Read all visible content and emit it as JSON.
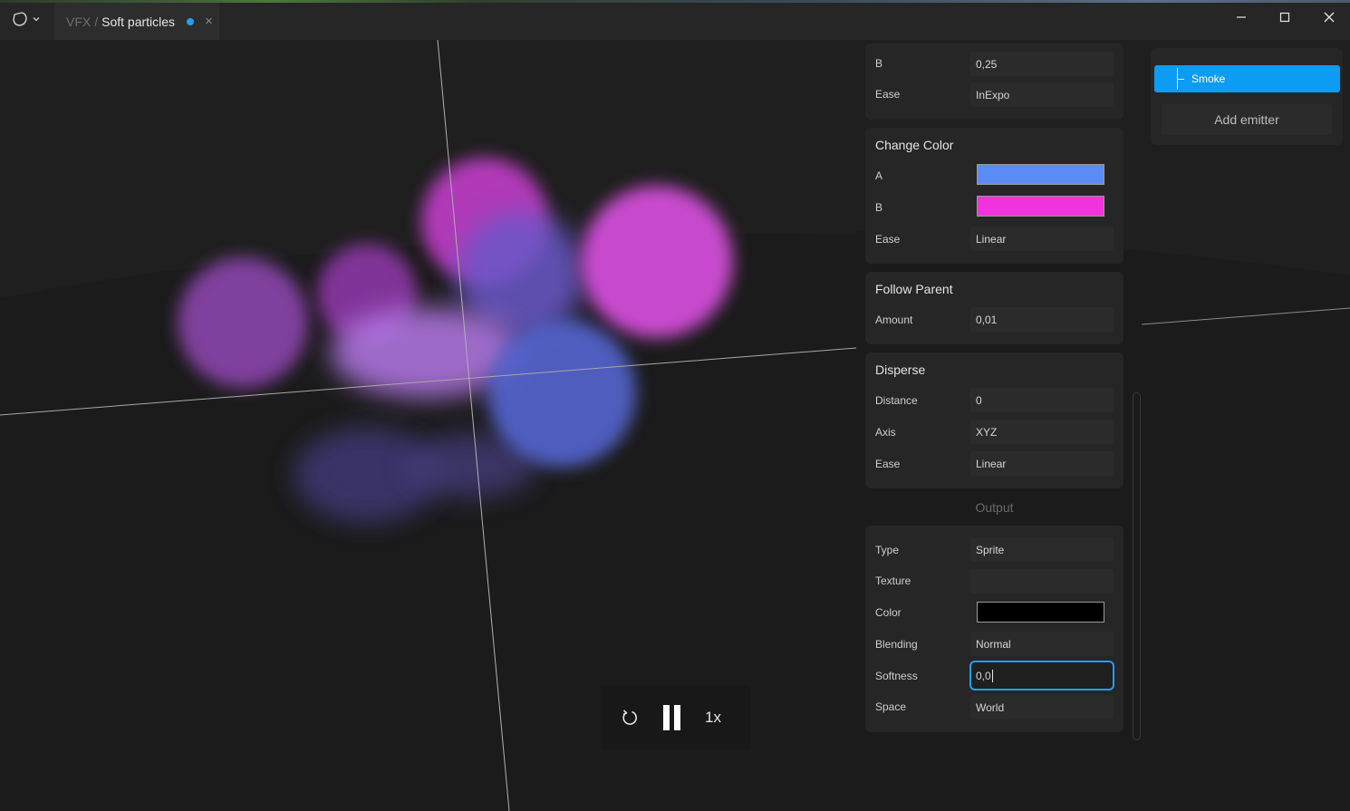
{
  "tab": {
    "crumb": "VFX",
    "separator": "/",
    "name": "Soft particles",
    "close": "×"
  },
  "icons": {
    "app": "particle-blob-icon",
    "menu": "chevron-down-icon",
    "minimize": "minimize-icon",
    "maximize": "maximize-icon",
    "close": "close-icon",
    "restart": "restart-icon",
    "pause": "pause-icon"
  },
  "playback": {
    "speed": "1x"
  },
  "panels": {
    "ease_prev": {
      "b_label": "B",
      "b_value": "0,25",
      "ease_label": "Ease",
      "ease_value": "InExpo"
    },
    "change_color": {
      "title": "Change Color",
      "a_label": "A",
      "a_color": "#5b8cf5",
      "b_label": "B",
      "b_color": "#f033dc",
      "ease_label": "Ease",
      "ease_value": "Linear"
    },
    "follow_parent": {
      "title": "Follow Parent",
      "amount_label": "Amount",
      "amount_value": "0,01"
    },
    "disperse": {
      "title": "Disperse",
      "distance_label": "Distance",
      "distance_value": "0",
      "axis_label": "Axis",
      "axis_value": "XYZ",
      "ease_label": "Ease",
      "ease_value": "Linear"
    },
    "output_heading": "Output",
    "output": {
      "type_label": "Type",
      "type_value": "Sprite",
      "texture_label": "Texture",
      "texture_value": "",
      "color_label": "Color",
      "color_value": "#000000",
      "blending_label": "Blending",
      "blending_value": "Normal",
      "softness_label": "Softness",
      "softness_value": "0,0",
      "space_label": "Space",
      "space_value": "World"
    }
  },
  "emitters": {
    "items": [
      {
        "label": "Smoke"
      }
    ],
    "add_label": "Add emitter"
  },
  "colors": {
    "accent": "#1da1f2",
    "selection": "#0d9cf3",
    "panel": "#262626"
  }
}
